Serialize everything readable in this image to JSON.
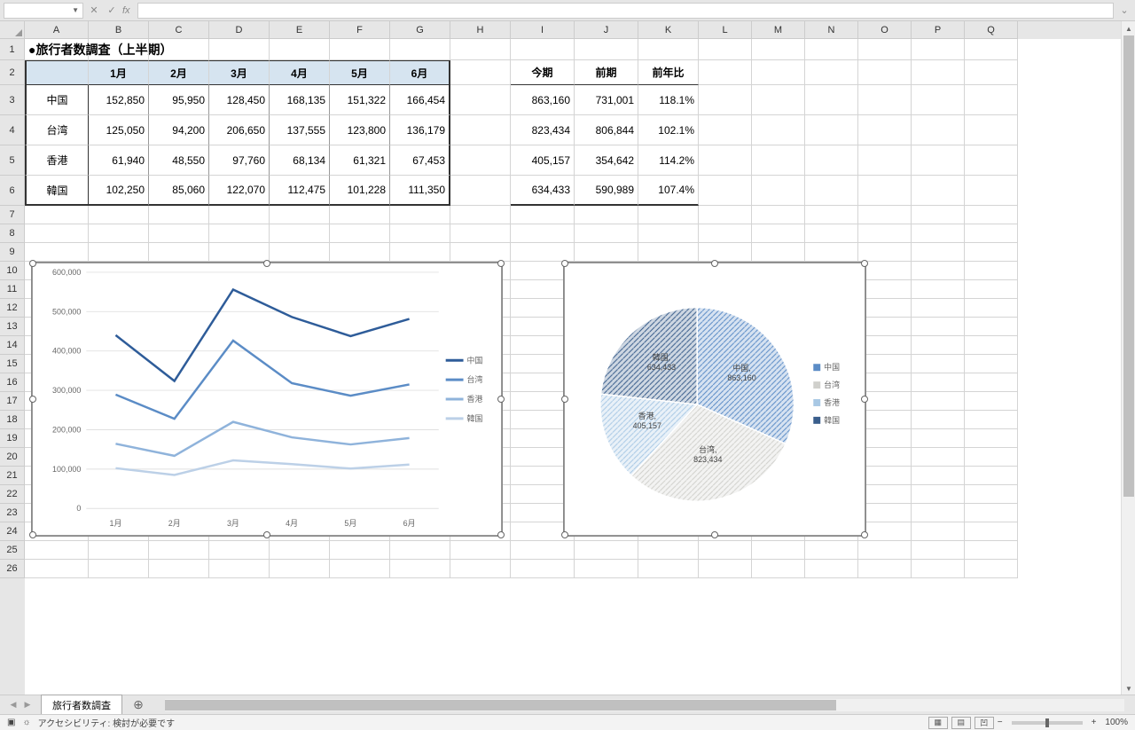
{
  "formulaBar": {
    "nameBox": "",
    "formula": ""
  },
  "columns": [
    "A",
    "B",
    "C",
    "D",
    "E",
    "F",
    "G",
    "H",
    "I",
    "J",
    "K",
    "L",
    "M",
    "N",
    "O",
    "P",
    "Q"
  ],
  "colWidths": {
    "A": 72,
    "B": 68,
    "C": 68,
    "D": 68,
    "E": 68,
    "F": 68,
    "G": 68,
    "H": 68,
    "I": 72,
    "J": 72,
    "K": 68,
    "L": 60,
    "M": 60,
    "N": 60,
    "O": 60,
    "P": 60,
    "Q": 60
  },
  "rowHeights": {
    "1": 24,
    "2": 28,
    "3": 34,
    "4": 34,
    "5": 34,
    "6": 34,
    "default": 21
  },
  "title": "●旅行者数調査（上半期）",
  "headers": {
    "months": [
      "1月",
      "2月",
      "3月",
      "4月",
      "5月",
      "6月"
    ],
    "summary": [
      "今期",
      "前期",
      "前年比"
    ]
  },
  "rows": [
    {
      "label": "中国",
      "vals": [
        "152,850",
        "95,950",
        "128,450",
        "168,135",
        "151,322",
        "166,454"
      ],
      "sum": [
        "863,160",
        "731,001",
        "118.1%"
      ]
    },
    {
      "label": "台湾",
      "vals": [
        "125,050",
        "94,200",
        "206,650",
        "137,555",
        "123,800",
        "136,179"
      ],
      "sum": [
        "823,434",
        "806,844",
        "102.1%"
      ]
    },
    {
      "label": "香港",
      "vals": [
        "61,940",
        "48,550",
        "97,760",
        "68,134",
        "61,321",
        "67,453"
      ],
      "sum": [
        "405,157",
        "354,642",
        "114.2%"
      ]
    },
    {
      "label": "韓国",
      "vals": [
        "102,250",
        "85,060",
        "122,070",
        "112,475",
        "101,228",
        "111,350"
      ],
      "sum": [
        "634,433",
        "590,989",
        "107.4%"
      ]
    }
  ],
  "sheetTab": "旅行者数調査",
  "statusBar": {
    "ready": "",
    "accessibility": "アクセシビリティ: 検討が必要です",
    "zoom": "100%"
  },
  "chart_data": [
    {
      "type": "line",
      "categories": [
        "1月",
        "2月",
        "3月",
        "4月",
        "5月",
        "6月"
      ],
      "series": [
        {
          "name": "中国",
          "color": "#2e5c99",
          "values": [
            152850,
            95950,
            128450,
            168135,
            151322,
            166454
          ],
          "cum": [
            440090,
            323760,
            555930,
            486299,
            437671,
            481436
          ]
        },
        {
          "name": "台湾",
          "color": "#5b8cc6",
          "values": [
            125050,
            94200,
            206650,
            137555,
            123800,
            136179
          ],
          "cum": [
            289240,
            227810,
            426480,
            318164,
            286349,
            314982
          ]
        },
        {
          "name": "香港",
          "color": "#8fb3db",
          "values": [
            61940,
            48550,
            97760,
            68134,
            61321,
            67453
          ],
          "cum": [
            164190,
            133610,
            219830,
            180609,
            162549,
            178803
          ]
        },
        {
          "name": "韓国",
          "color": "#bcd0e7",
          "values": [
            102250,
            85060,
            122070,
            112475,
            101228,
            111350
          ],
          "cum": [
            102250,
            85060,
            122070,
            112475,
            101228,
            111350
          ]
        }
      ],
      "ylim": [
        0,
        600000
      ],
      "ystep": 100000
    },
    {
      "type": "pie",
      "series": [
        {
          "name": "中国",
          "value": 863160,
          "label": "中国,\n863,160",
          "color": "#5b8cc6"
        },
        {
          "name": "台湾",
          "value": 823434,
          "label": "台湾,\n823,434",
          "color": "#d0d0cc"
        },
        {
          "name": "香港",
          "value": 405157,
          "label": "香港,\n405,157",
          "color": "#a8c8e4"
        },
        {
          "name": "韓国",
          "value": 634433,
          "label": "韓国,\n634,433",
          "color": "#3a5e8c"
        }
      ]
    }
  ]
}
